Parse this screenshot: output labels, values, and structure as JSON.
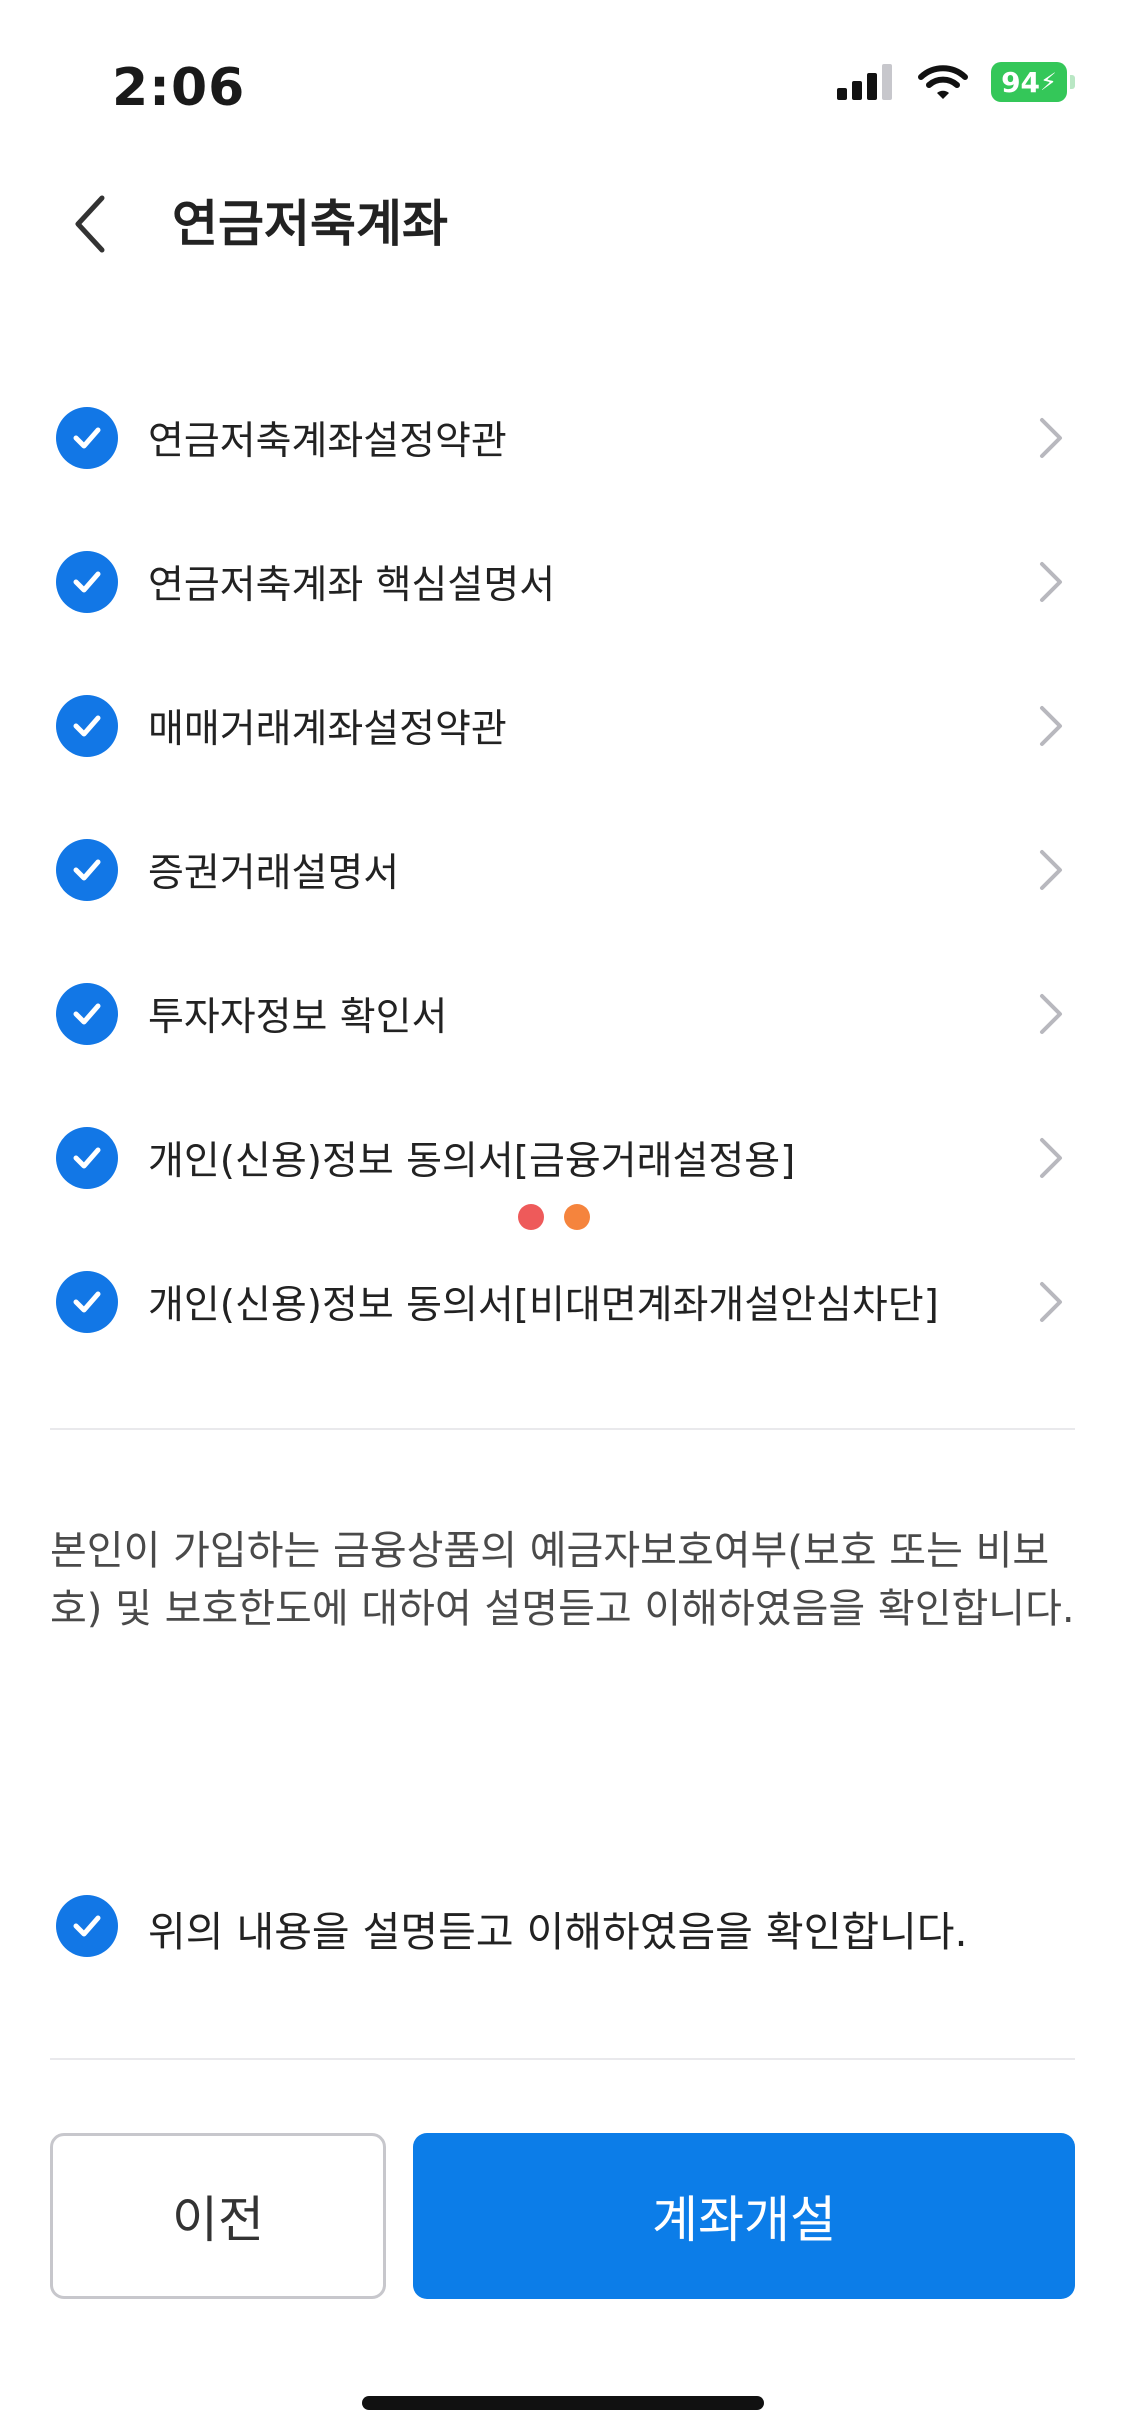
{
  "status_bar": {
    "time": "2:06",
    "battery": "94"
  },
  "header": {
    "title": "연금저축계좌"
  },
  "agreements": [
    {
      "label": "연금저축계좌설정약관"
    },
    {
      "label": "연금저축계좌 핵심설명서"
    },
    {
      "label": "매매거래계좌설정약관"
    },
    {
      "label": "증권거래설명서"
    },
    {
      "label": "투자자정보 확인서"
    },
    {
      "label": "개인(신용)정보 동의서[금융거래설정용]"
    },
    {
      "label": "개인(신용)정보 동의서[비대면계좌개설안심차단]"
    }
  ],
  "notice_text": "본인이 가입하는 금융상품의 예금자보호여부(보호 또는 비보호) 및 보호한도에 대하여 설명듣고 이해하였음을 확인합니다.",
  "confirm_label": "위의 내용을 설명듣고 이해하였음을 확인합니다.",
  "buttons": {
    "prev": "이전",
    "open_account": "계좌개설"
  },
  "colors": {
    "accent": "#0c7de8",
    "check": "#1277e6",
    "dot_red": "#ee5a5a",
    "dot_orange": "#f5843d",
    "battery": "#34c759"
  }
}
